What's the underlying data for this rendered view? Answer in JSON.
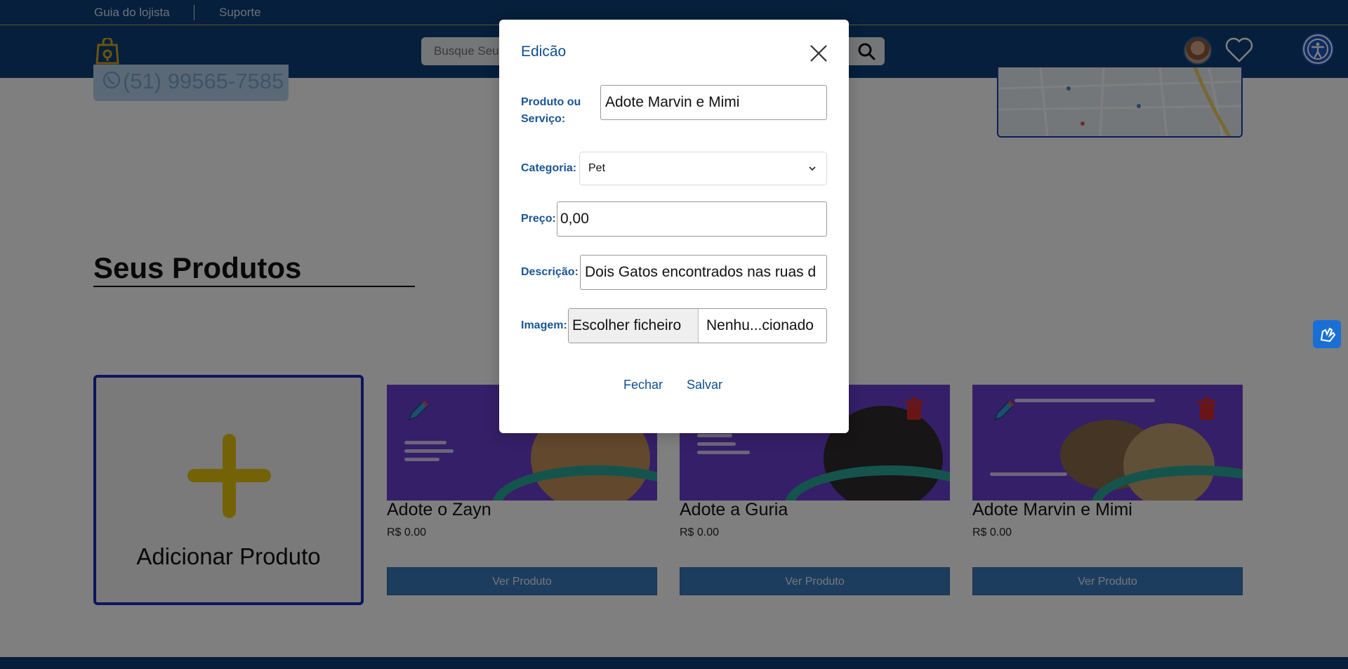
{
  "topbar": {
    "links": [
      "Guia do lojista",
      "Suporte"
    ]
  },
  "header": {
    "search_placeholder": "Busque Seu..."
  },
  "contact": {
    "phone": "(51) 99565-7585"
  },
  "section": {
    "title": "Seus Produtos"
  },
  "add_card": {
    "label": "Adicionar Produto"
  },
  "products": [
    {
      "name": "Adote o Zayn",
      "price": "R$ 0.00",
      "button": "Ver Produto"
    },
    {
      "name": "Adote a Guria",
      "price": "R$ 0.00",
      "button": "Ver Produto"
    },
    {
      "name": "Adote Marvin e Mimi",
      "price": "R$ 0.00",
      "button": "Ver Produto"
    }
  ],
  "modal": {
    "title": "Edicão",
    "fields": {
      "produto_label": "Produto ou Serviço:",
      "produto_value": "Adote Marvin e Mimi",
      "categoria_label": "Categoria:",
      "categoria_value": "Pet",
      "preco_label": "Preço:",
      "preco_value": "0,00",
      "descricao_label": "Descrição:",
      "descricao_value": "Dois Gatos encontrados nas ruas d",
      "imagem_label": "Imagem:",
      "file_button": "Escolher ficheiro",
      "file_status": "Nenhu...cionado"
    },
    "buttons": {
      "close": "Fechar",
      "save": "Salvar"
    }
  },
  "colors": {
    "header": "#0b3f78",
    "accent": "#e8c70c",
    "button": "#3a7abf",
    "modal_text": "#0f4f8f"
  }
}
